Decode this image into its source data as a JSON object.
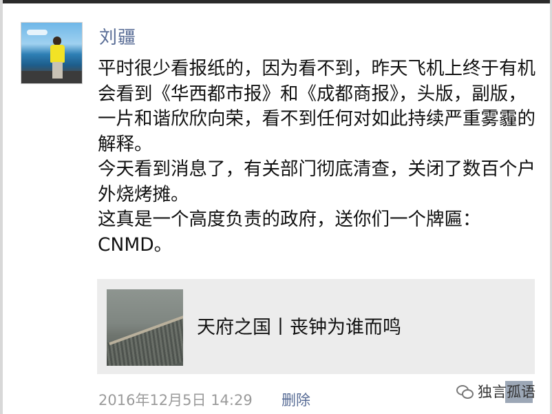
{
  "post": {
    "author": "刘疆",
    "paragraphs": [
      "平时很少看报纸的，因为看不到，昨天飞机上终于有机会看到《华西都市报》和《成都商报》，头版，副版，一片和谐欣欣向荣，看不到任何对如此持续严重雾霾的解释。",
      "今天看到消息了，有关部门彻底清查，关闭了数百个户外烧烤摊。",
      "这真是一个高度负责的政府，送你们一个牌匾：CNMD。"
    ],
    "link": {
      "title": "天府之国丨丧钟为谁而鸣"
    },
    "timestamp": "2016年12月5日 14:29",
    "delete_label": "删除"
  },
  "watermark": {
    "icon": "wechat-icon",
    "text": "独言孤语"
  },
  "colors": {
    "name_link": "#576b95",
    "card_bg": "#ececec",
    "timestamp": "#9a9a9a"
  }
}
